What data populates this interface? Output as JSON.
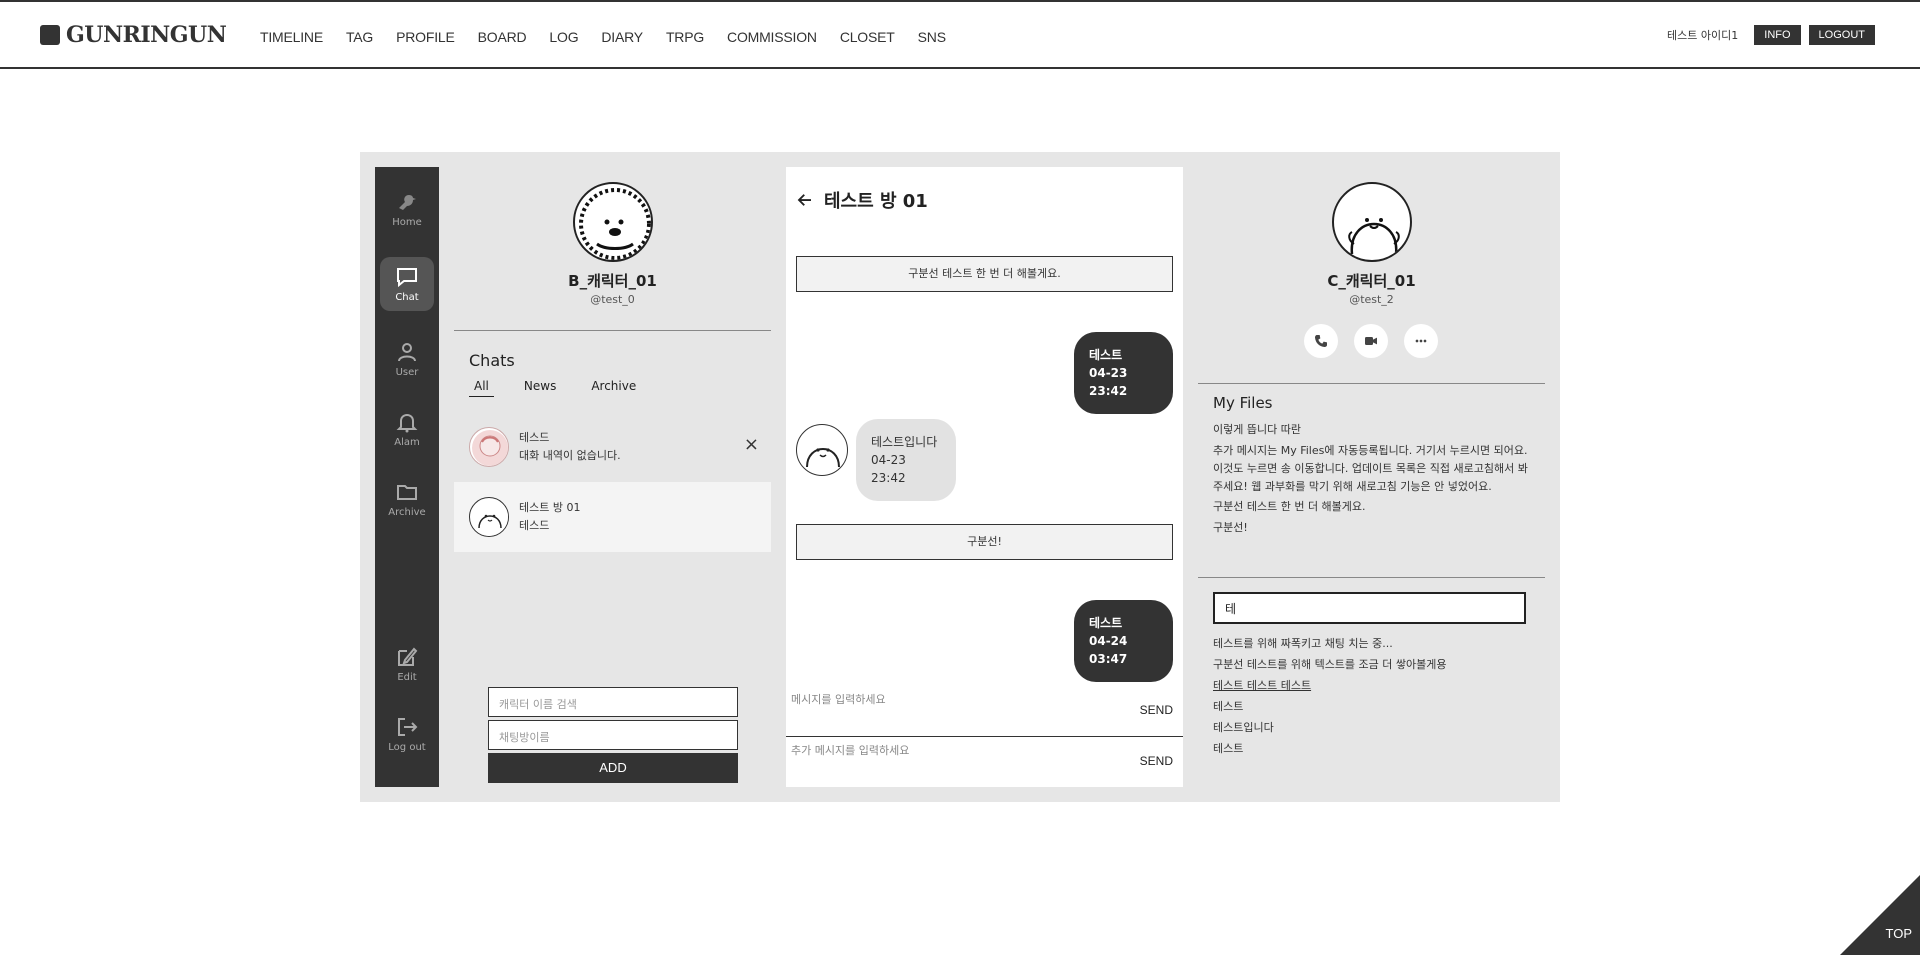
{
  "header": {
    "logo": "GUNRINGUN",
    "nav": [
      "TIMELINE",
      "TAG",
      "PROFILE",
      "BOARD",
      "LOG",
      "DIARY",
      "TRPG",
      "COMMISSION",
      "CLOSET",
      "SNS"
    ],
    "user_id": "테스트 아이디1",
    "info_label": "INFO",
    "logout_label": "LOGOUT"
  },
  "rail": {
    "home": "Home",
    "chat": "Chat",
    "user": "User",
    "alam": "Alam",
    "archive": "Archive",
    "edit": "Edit",
    "logout": "Log out"
  },
  "left": {
    "name": "B_캐릭터_01",
    "handle": "@test_0",
    "chats_title": "Chats",
    "tabs": [
      "All",
      "News",
      "Archive"
    ],
    "chats": [
      {
        "name": "테스드",
        "preview": "대화 내역이 없습니다."
      },
      {
        "name": "테스트 방 01",
        "preview": "테스드"
      }
    ],
    "close_glyph": "×",
    "search_placeholder": "캐릭터 이름 검색",
    "room_placeholder": "채팅방이름",
    "add_label": "ADD"
  },
  "chat": {
    "room_title": "테스트 방 01",
    "notice1": "구분선 테스트 한 번 더 해볼게요.",
    "notice2": "구분선!",
    "msg1": {
      "name": "테스트",
      "time": "04-23 23:42"
    },
    "msg2": {
      "name": "테스트입니다",
      "time": "04-23 23:42"
    },
    "msg3": {
      "name": "테스트",
      "time": "04-24 03:47"
    },
    "input_placeholder": "메시지를 입력하세요",
    "extra_placeholder": "추가 메시지를 입력하세요",
    "send_label": "SEND"
  },
  "right": {
    "name": "C_캐릭터_01",
    "handle": "@test_2",
    "files_title": "My Files",
    "files": [
      "이렇게 뜹니다 따란",
      "추가 메시지는 My Files에 자동등록됩니다. 거기서 누르시면 되어요. 이것도 누르면 송 이동합니다. 업데이트 목록은 직접 새로고침해서 봐주세요! 웹 과부화를 막기 위해 새로고침 기능은 안 넣었어요.",
      "구분선 테스트 한 번 더 해볼게요.",
      "구분선!"
    ],
    "search_value": "테",
    "results": [
      "테스트를 위해 짜폭키고 채팅 치는 중...",
      "구분선 테스트를 위해 텍스트를 조금 더 쌓아볼게용",
      "테스트 테스트 테스트",
      "테스트",
      "테스트입니다",
      "테스트"
    ]
  },
  "top_label": "TOP"
}
